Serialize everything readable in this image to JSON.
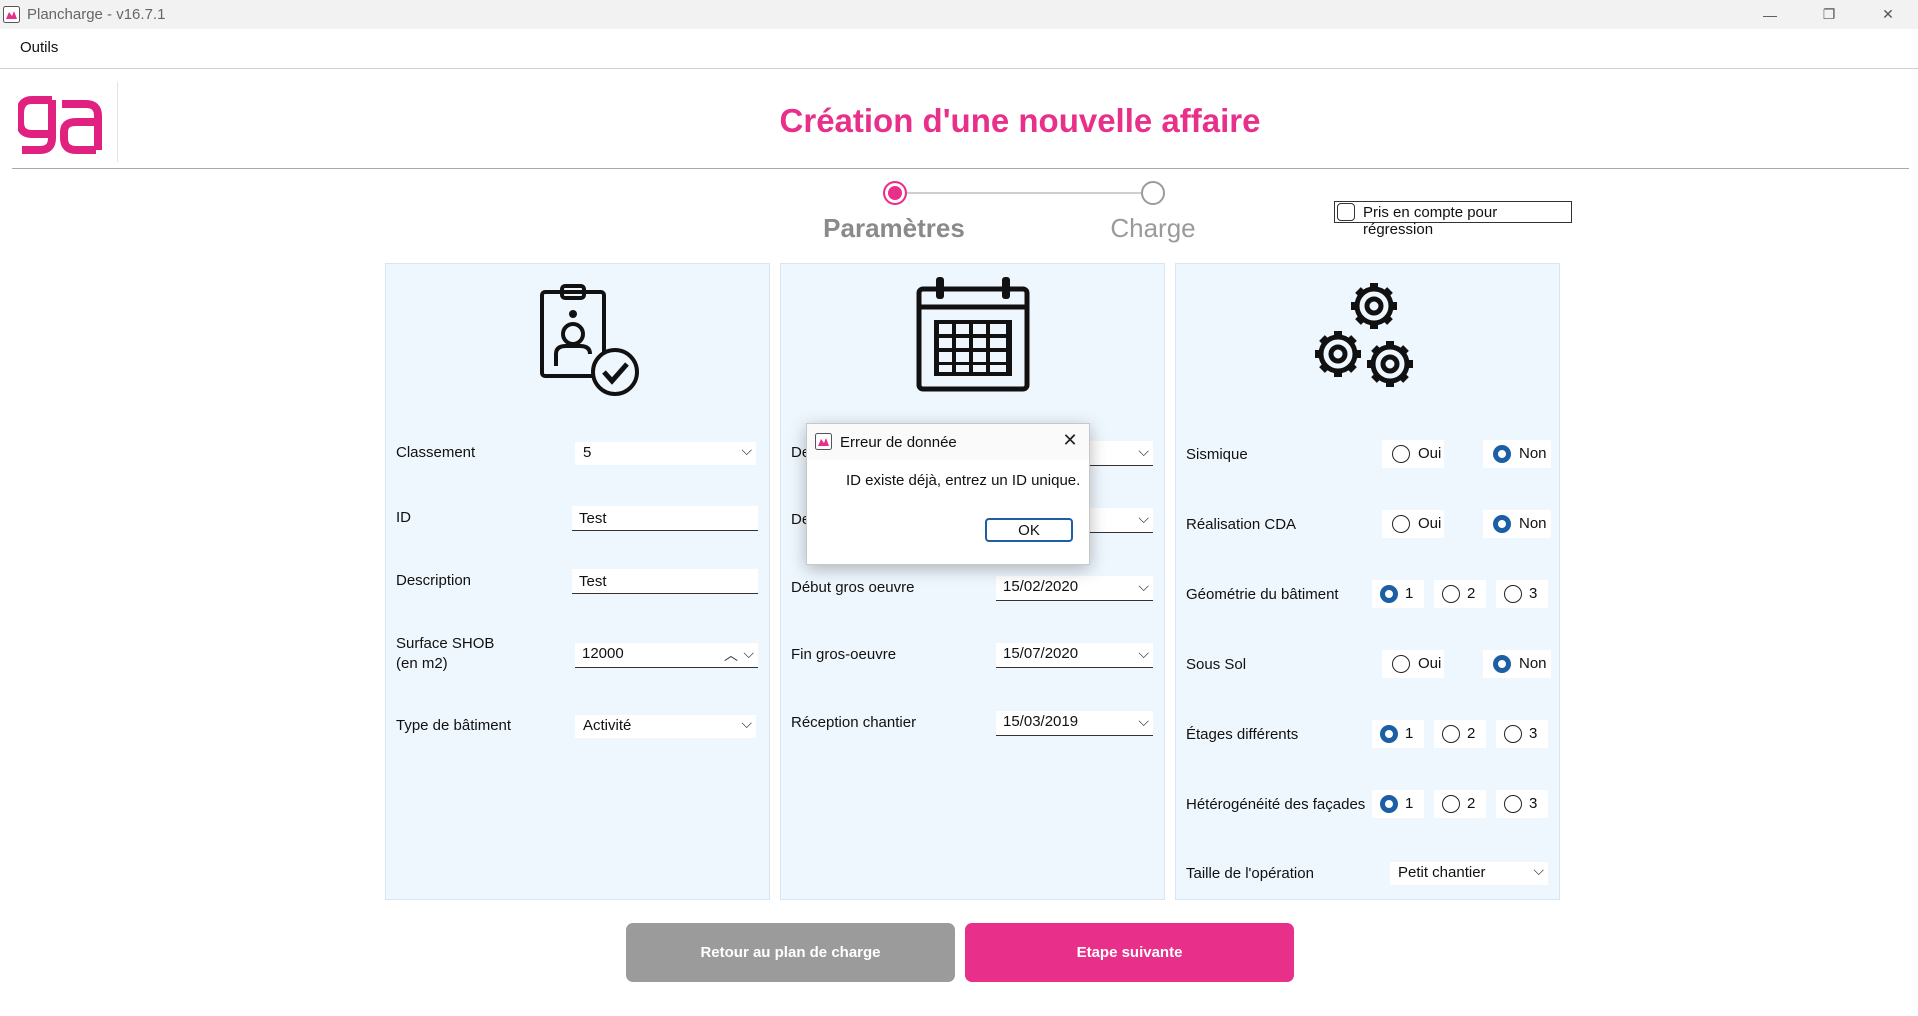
{
  "window": {
    "title": "Plancharge - v16.7.1",
    "minimize": "—",
    "restore": "❐",
    "close": "✕"
  },
  "menu": {
    "tools": "Outils"
  },
  "header": {
    "title": "Création d'une nouvelle affaire"
  },
  "stepper": {
    "steps": [
      {
        "label": "Paramètres",
        "state": "active"
      },
      {
        "label": "Charge",
        "state": "inactive"
      }
    ]
  },
  "regression": {
    "label": "Pris en compte pour régression",
    "checked": false
  },
  "panel_general": {
    "icon": "badge-check-icon",
    "fields": {
      "classement": {
        "label": "Classement",
        "value": "5"
      },
      "id": {
        "label": "ID",
        "value": "Test"
      },
      "description": {
        "label": "Description",
        "value": "Test"
      },
      "surface": {
        "label_line1": "Surface SHOB",
        "label_line2": "(en m2)",
        "value": "12000"
      },
      "type": {
        "label": "Type de bâtiment",
        "value": "Activité"
      }
    }
  },
  "panel_dates": {
    "icon": "calendar-icon",
    "fields": {
      "row1_label_visible": "De",
      "row2_label_visible": "De",
      "debut_go": {
        "label": "Début gros oeuvre",
        "value": "15/02/2020"
      },
      "fin_go": {
        "label": "Fin gros-oeuvre",
        "value": "15/07/2020"
      },
      "reception": {
        "label": "Réception chantier",
        "value": "15/03/2019"
      }
    }
  },
  "panel_options": {
    "icon": "gears-icon",
    "rows": [
      {
        "label": "Sismique",
        "options": [
          "Oui",
          "Non"
        ],
        "selected": "Non"
      },
      {
        "label": "Réalisation CDA",
        "options": [
          "Oui",
          "Non"
        ],
        "selected": "Non"
      },
      {
        "label": "Géométrie du bâtiment",
        "options": [
          "1",
          "2",
          "3"
        ],
        "selected": "1"
      },
      {
        "label": "Sous Sol",
        "options": [
          "Oui",
          "Non"
        ],
        "selected": "Non"
      },
      {
        "label": "Étages différents",
        "options": [
          "1",
          "2",
          "3"
        ],
        "selected": "1"
      },
      {
        "label": "Hétérogénéité des façades",
        "options": [
          "1",
          "2",
          "3"
        ],
        "selected": "1"
      }
    ],
    "taille": {
      "label": "Taille de l'opération",
      "value": "Petit chantier"
    }
  },
  "buttons": {
    "back": "Retour au plan de charge",
    "next": "Etape suivante"
  },
  "dialog": {
    "title": "Erreur de donnée",
    "message": "ID existe déjà, entrez un ID unique.",
    "ok": "OK",
    "close": "✕"
  },
  "colors": {
    "accent": "#e8308a",
    "panel_bg": "#eff7fe",
    "radio_selected": "#1c5fa4",
    "secondary_button": "#9b9b9b"
  }
}
